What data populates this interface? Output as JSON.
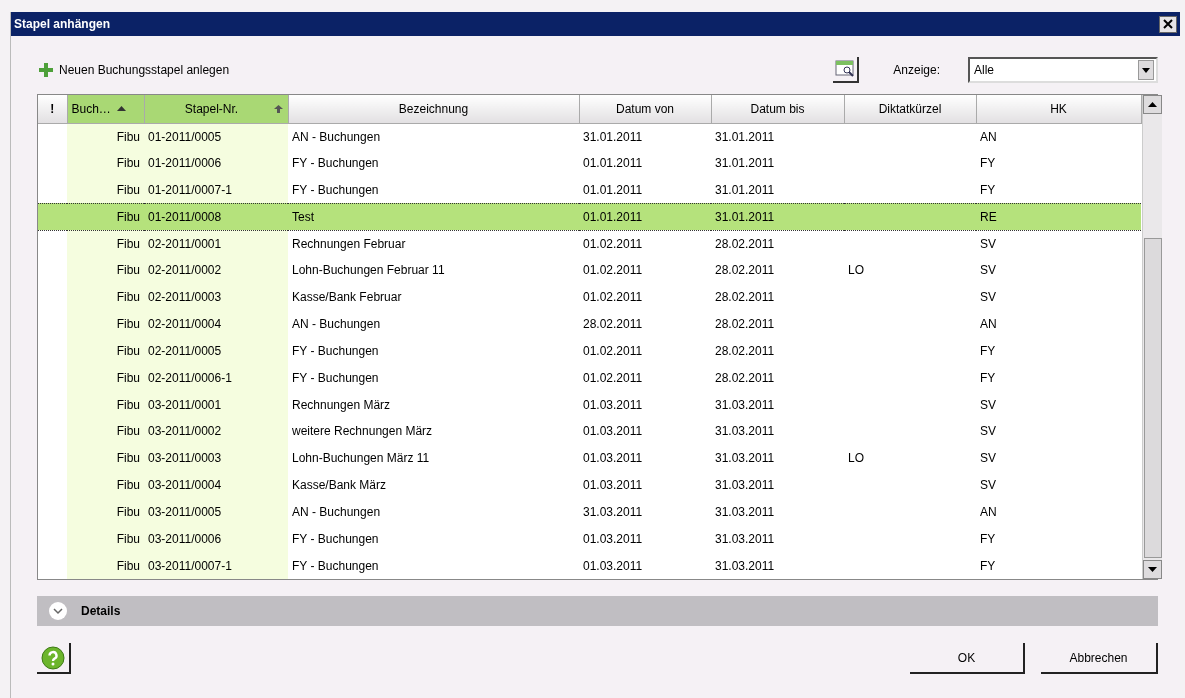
{
  "window": {
    "title": "Stapel anhängen"
  },
  "toolbar": {
    "new_link": "Neuen Buchungsstapel anlegen",
    "display_label": "Anzeige:",
    "display_value": "Alle"
  },
  "table": {
    "columns": [
      {
        "label": "!",
        "highlighted": false,
        "kind": "flag"
      },
      {
        "label": "Buch…",
        "highlighted": true,
        "kind": "sorted"
      },
      {
        "label": "Stapel-Nr.",
        "highlighted": true,
        "kind": "sorted_secondary"
      },
      {
        "label": "Bezeichnung",
        "highlighted": false,
        "kind": "plain"
      },
      {
        "label": "Datum von",
        "highlighted": false,
        "kind": "plain"
      },
      {
        "label": "Datum bis",
        "highlighted": false,
        "kind": "plain"
      },
      {
        "label": "Diktatkürzel",
        "highlighted": false,
        "kind": "plain"
      },
      {
        "label": "HK",
        "highlighted": false,
        "kind": "plain"
      }
    ],
    "rows": [
      {
        "cells": [
          "",
          "Fibu",
          "01-2011/0005",
          "AN - Buchungen",
          "31.01.2011",
          "31.01.2011",
          "",
          "AN"
        ],
        "selected": false
      },
      {
        "cells": [
          "",
          "Fibu",
          "01-2011/0006",
          "FY - Buchungen",
          "01.01.2011",
          "31.01.2011",
          "",
          "FY"
        ],
        "selected": false
      },
      {
        "cells": [
          "",
          "Fibu",
          "01-2011/0007-1",
          "FY - Buchungen",
          "01.01.2011",
          "31.01.2011",
          "",
          "FY"
        ],
        "selected": false
      },
      {
        "cells": [
          "",
          "Fibu",
          "01-2011/0008",
          "Test",
          "01.01.2011",
          "31.01.2011",
          "",
          "RE"
        ],
        "selected": true
      },
      {
        "cells": [
          "",
          "Fibu",
          "02-2011/0001",
          "Rechnungen Februar",
          "01.02.2011",
          "28.02.2011",
          "",
          "SV"
        ],
        "selected": false
      },
      {
        "cells": [
          "",
          "Fibu",
          "02-2011/0002",
          "Lohn-Buchungen Februar 11",
          "01.02.2011",
          "28.02.2011",
          "LO",
          "SV"
        ],
        "selected": false
      },
      {
        "cells": [
          "",
          "Fibu",
          "02-2011/0003",
          "Kasse/Bank Februar",
          "01.02.2011",
          "28.02.2011",
          "",
          "SV"
        ],
        "selected": false
      },
      {
        "cells": [
          "",
          "Fibu",
          "02-2011/0004",
          "AN - Buchungen",
          "28.02.2011",
          "28.02.2011",
          "",
          "AN"
        ],
        "selected": false
      },
      {
        "cells": [
          "",
          "Fibu",
          "02-2011/0005",
          "FY - Buchungen",
          "01.02.2011",
          "28.02.2011",
          "",
          "FY"
        ],
        "selected": false
      },
      {
        "cells": [
          "",
          "Fibu",
          "02-2011/0006-1",
          "FY - Buchungen",
          "01.02.2011",
          "28.02.2011",
          "",
          "FY"
        ],
        "selected": false
      },
      {
        "cells": [
          "",
          "Fibu",
          "03-2011/0001",
          "Rechnungen März",
          "01.03.2011",
          "31.03.2011",
          "",
          "SV"
        ],
        "selected": false
      },
      {
        "cells": [
          "",
          "Fibu",
          "03-2011/0002",
          "weitere Rechnungen März",
          "01.03.2011",
          "31.03.2011",
          "",
          "SV"
        ],
        "selected": false
      },
      {
        "cells": [
          "",
          "Fibu",
          "03-2011/0003",
          "Lohn-Buchungen März 11",
          "01.03.2011",
          "31.03.2011",
          "LO",
          "SV"
        ],
        "selected": false
      },
      {
        "cells": [
          "",
          "Fibu",
          "03-2011/0004",
          "Kasse/Bank März",
          "01.03.2011",
          "31.03.2011",
          "",
          "SV"
        ],
        "selected": false
      },
      {
        "cells": [
          "",
          "Fibu",
          "03-2011/0005",
          "AN - Buchungen",
          "31.03.2011",
          "31.03.2011",
          "",
          "AN"
        ],
        "selected": false
      },
      {
        "cells": [
          "",
          "Fibu",
          "03-2011/0006",
          "FY - Buchungen",
          "01.03.2011",
          "31.03.2011",
          "",
          "FY"
        ],
        "selected": false
      },
      {
        "cells": [
          "",
          "Fibu",
          "03-2011/0007-1",
          "FY - Buchungen",
          "01.03.2011",
          "31.03.2011",
          "",
          "FY"
        ],
        "selected": false
      }
    ]
  },
  "details": {
    "label": "Details",
    "expanded": false
  },
  "buttons": [
    "OK",
    "Abbrechen"
  ]
}
